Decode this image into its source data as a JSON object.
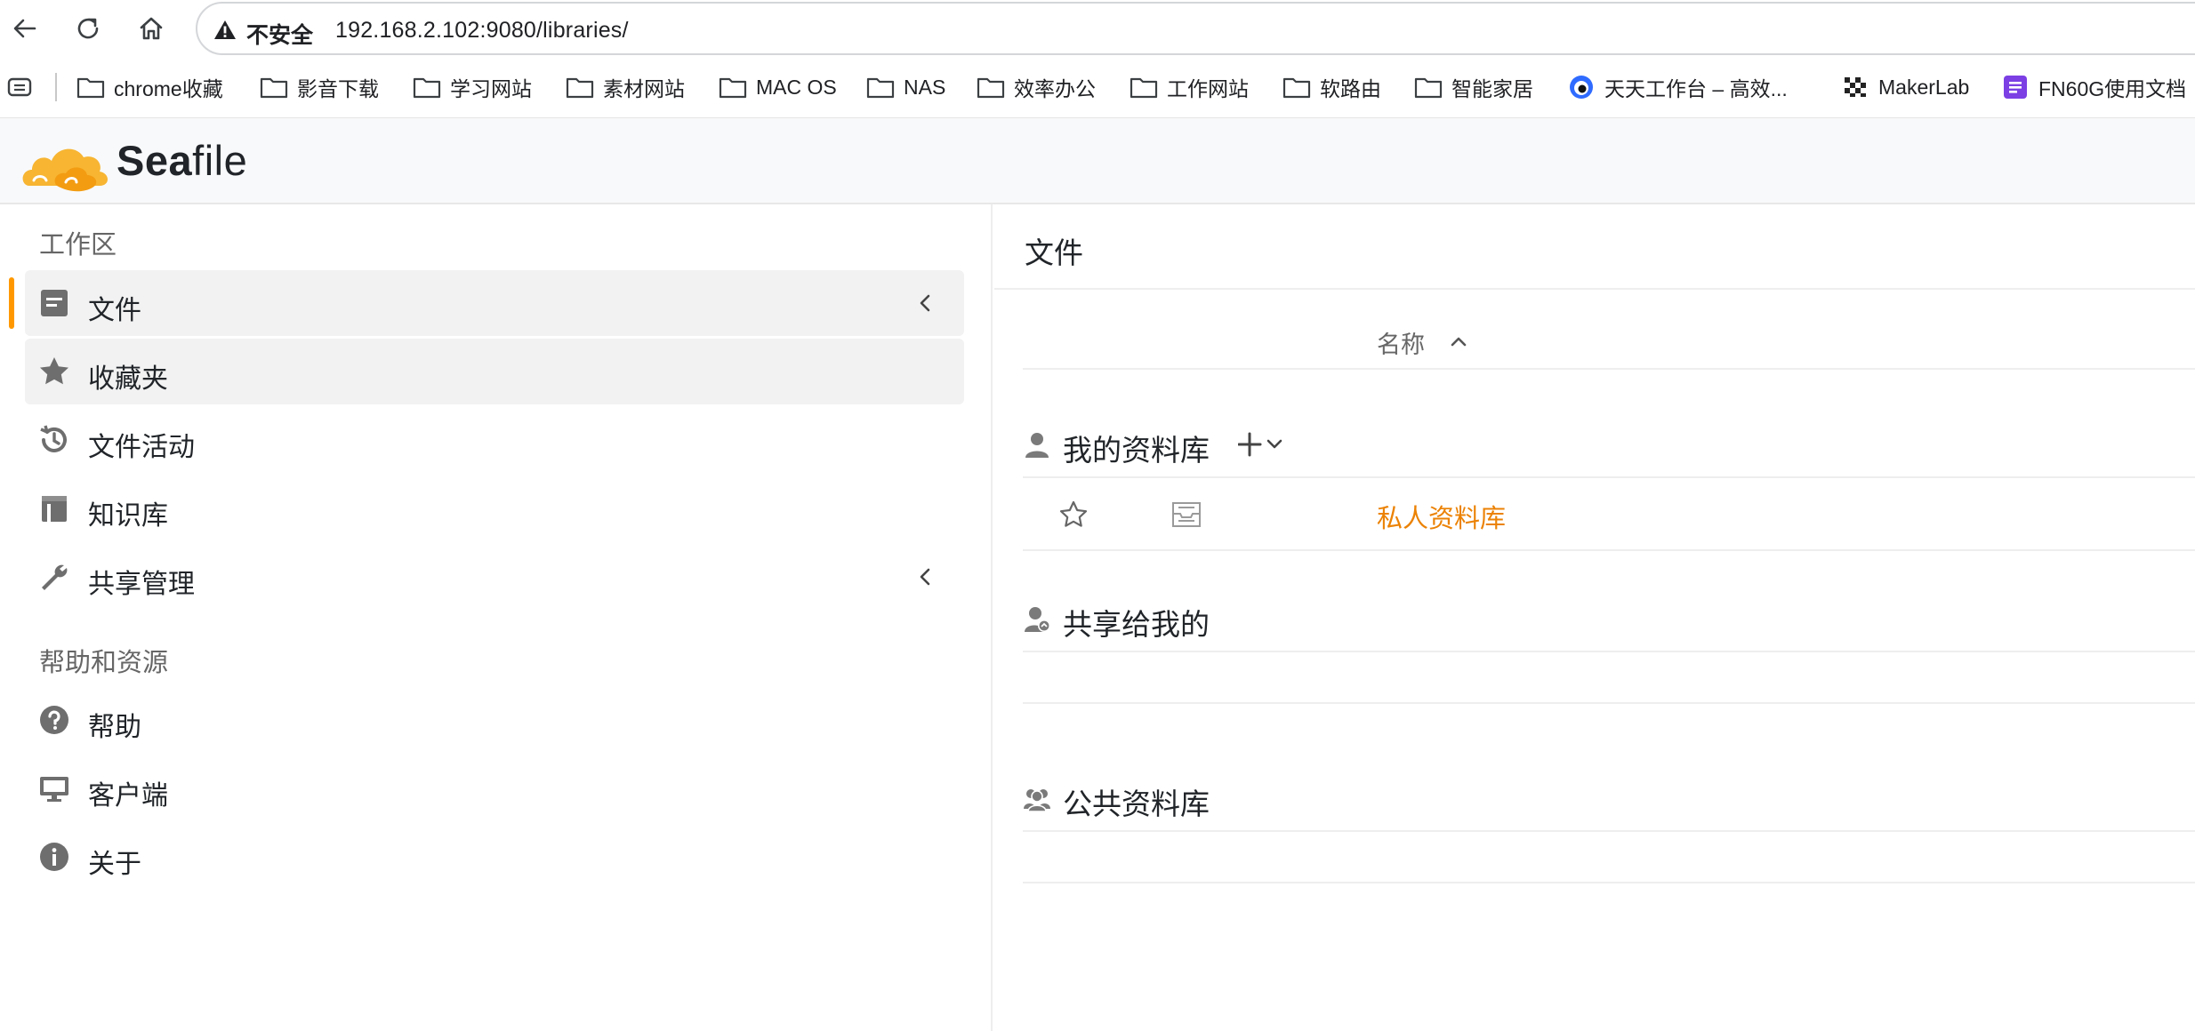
{
  "browser": {
    "security_label": "不安全",
    "url": "192.168.2.102:9080/libraries/",
    "bookmarks": [
      {
        "label": "chrome收藏",
        "icon": "folder-icon"
      },
      {
        "label": "影音下载",
        "icon": "folder-icon"
      },
      {
        "label": "学习网站",
        "icon": "folder-icon"
      },
      {
        "label": "素材网站",
        "icon": "folder-icon"
      },
      {
        "label": "MAC OS",
        "icon": "folder-icon"
      },
      {
        "label": "NAS",
        "icon": "folder-icon"
      },
      {
        "label": "效率办公",
        "icon": "folder-icon"
      },
      {
        "label": "工作网站",
        "icon": "folder-icon"
      },
      {
        "label": "软路由",
        "icon": "folder-icon"
      },
      {
        "label": "智能家居",
        "icon": "folder-icon"
      },
      {
        "label": "天天工作台 – 高效...",
        "icon": "site-favicon"
      },
      {
        "label": "MakerLab",
        "icon": "makerlab-favicon"
      },
      {
        "label": "FN60G使用文档",
        "icon": "doc-favicon"
      }
    ]
  },
  "app": {
    "logo_part1": "Sea",
    "logo_part2": "file",
    "brand_color": "#eb8205"
  },
  "sidebar": {
    "workspace_heading": "工作区",
    "items": [
      {
        "label": "文件",
        "icon": "file-icon"
      },
      {
        "label": "收藏夹",
        "icon": "star-icon"
      },
      {
        "label": "文件活动",
        "icon": "history-icon"
      },
      {
        "label": "知识库",
        "icon": "wiki-icon"
      },
      {
        "label": "共享管理",
        "icon": "wrench-icon"
      }
    ],
    "help_heading": "帮助和资源",
    "help_items": [
      {
        "label": "帮助",
        "icon": "help-icon"
      },
      {
        "label": "客户端",
        "icon": "monitor-icon"
      },
      {
        "label": "关于",
        "icon": "info-icon"
      }
    ]
  },
  "main": {
    "title": "文件",
    "sort_label": "名称",
    "my_libraries": {
      "title": "我的资料库",
      "libraries": [
        {
          "name": "私人资料库"
        }
      ]
    },
    "shared_with_me": {
      "title": "共享给我的"
    },
    "public_libraries": {
      "title": "公共资料库"
    }
  }
}
